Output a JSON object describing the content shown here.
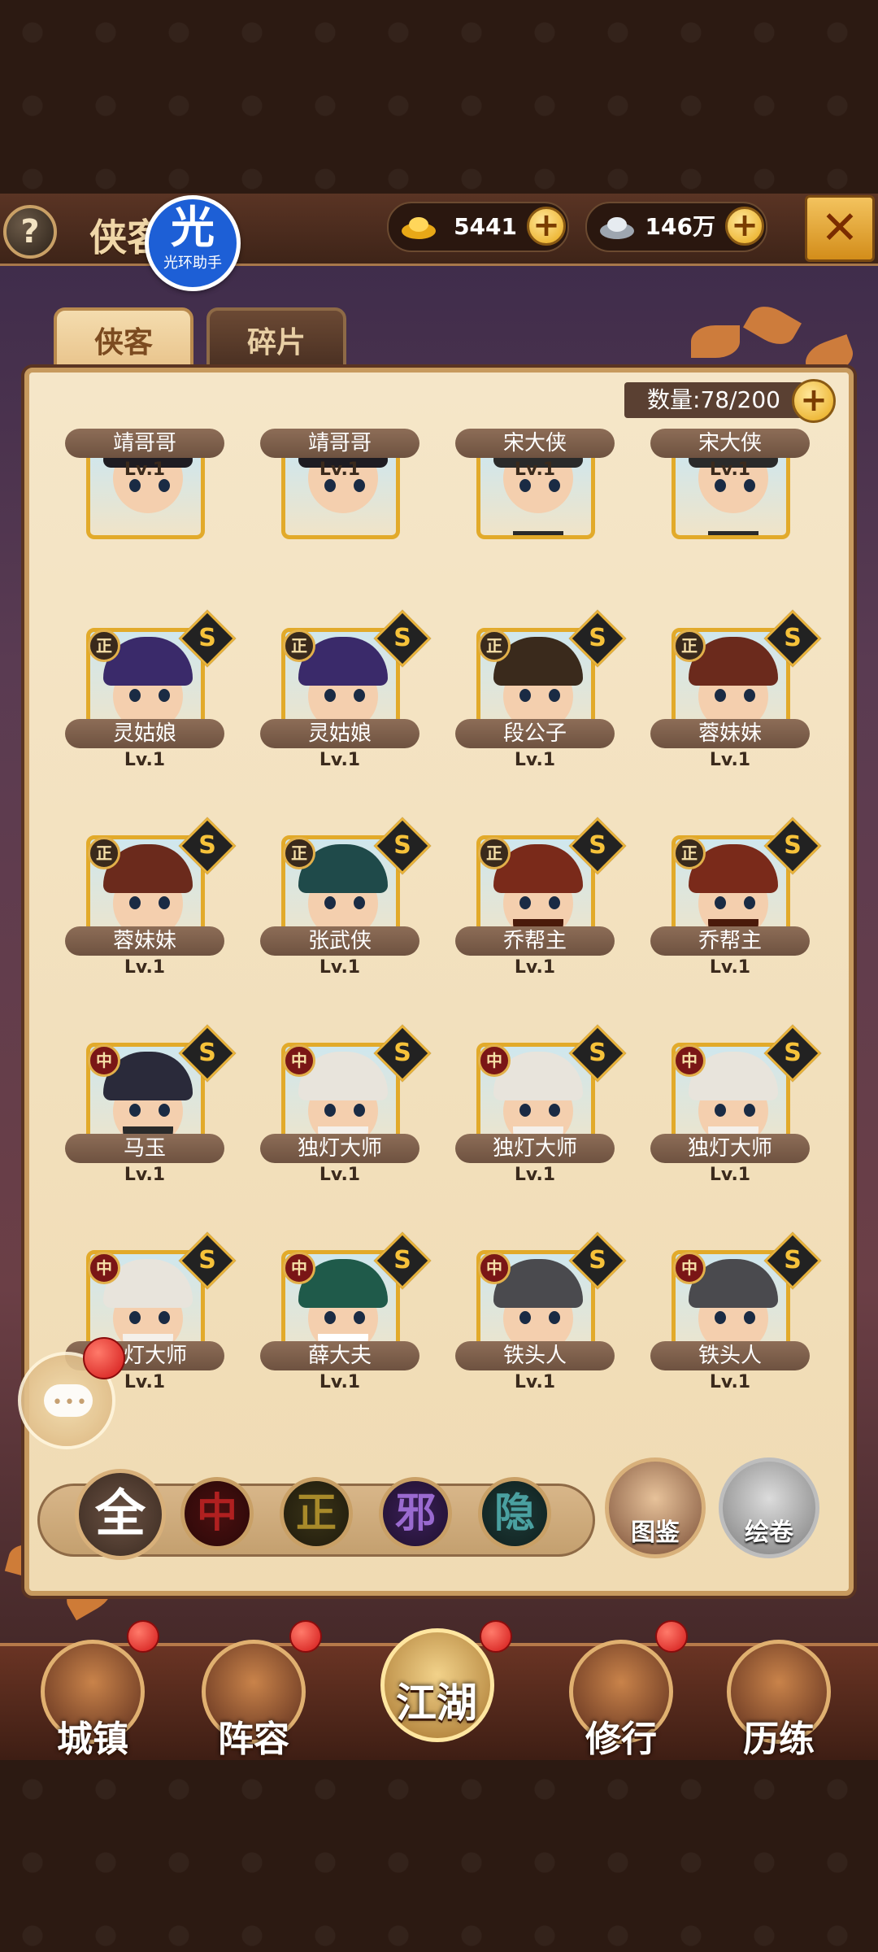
{
  "header": {
    "title": "侠客",
    "help_label": "?",
    "close_label": "✕",
    "logo": {
      "big": "光",
      "small": "光环助手"
    },
    "gold": {
      "value": "5441",
      "icon": "gold-ingot-icon"
    },
    "silver": {
      "value": "146万",
      "icon": "silver-ingot-icon"
    },
    "plus_label": "+"
  },
  "tabs": [
    {
      "label": "侠客"
    },
    {
      "label": "碎片"
    }
  ],
  "capacity": {
    "label": "数量:78/200"
  },
  "heroes": [
    {
      "name": "靖哥哥",
      "level": "Lv.1",
      "faction": "",
      "rank": "",
      "hair": "#1e1c22",
      "beard": ""
    },
    {
      "name": "靖哥哥",
      "level": "Lv.1",
      "faction": "",
      "rank": "",
      "hair": "#1e1c22",
      "beard": ""
    },
    {
      "name": "宋大侠",
      "level": "Lv.1",
      "faction": "",
      "rank": "",
      "hair": "#2a2a2a",
      "beard": "#2a2a2a"
    },
    {
      "name": "宋大侠",
      "level": "Lv.1",
      "faction": "",
      "rank": "",
      "hair": "#2a2a2a",
      "beard": "#2a2a2a"
    },
    {
      "name": "灵姑娘",
      "level": "Lv.1",
      "faction": "正",
      "rank": "S",
      "hair": "#3a2a6a",
      "beard": ""
    },
    {
      "name": "灵姑娘",
      "level": "Lv.1",
      "faction": "正",
      "rank": "S",
      "hair": "#3a2a6a",
      "beard": ""
    },
    {
      "name": "段公子",
      "level": "Lv.1",
      "faction": "正",
      "rank": "S",
      "hair": "#3a2a1c",
      "beard": ""
    },
    {
      "name": "蓉妹妹",
      "level": "Lv.1",
      "faction": "正",
      "rank": "S",
      "hair": "#6b2a1c",
      "beard": ""
    },
    {
      "name": "蓉妹妹",
      "level": "Lv.1",
      "faction": "正",
      "rank": "S",
      "hair": "#6b2a1c",
      "beard": ""
    },
    {
      "name": "张武侠",
      "level": "Lv.1",
      "faction": "正",
      "rank": "S",
      "hair": "#1f4a4a",
      "beard": ""
    },
    {
      "name": "乔帮主",
      "level": "Lv.1",
      "faction": "正",
      "rank": "S",
      "hair": "#7a2a1a",
      "beard": "#4a1a0a"
    },
    {
      "name": "乔帮主",
      "level": "Lv.1",
      "faction": "正",
      "rank": "S",
      "hair": "#7a2a1a",
      "beard": "#4a1a0a"
    },
    {
      "name": "马玉",
      "level": "Lv.1",
      "faction": "中",
      "rank": "S",
      "hair": "#2a2a3a",
      "beard": "#2a2a2a"
    },
    {
      "name": "独灯大师",
      "level": "Lv.1",
      "faction": "中",
      "rank": "S",
      "hair": "#e8e4dc",
      "beard": "#f4f0ea"
    },
    {
      "name": "独灯大师",
      "level": "Lv.1",
      "faction": "中",
      "rank": "S",
      "hair": "#e8e4dc",
      "beard": "#f4f0ea"
    },
    {
      "name": "独灯大师",
      "level": "Lv.1",
      "faction": "中",
      "rank": "S",
      "hair": "#e8e4dc",
      "beard": "#f4f0ea"
    },
    {
      "name": "独灯大师",
      "level": "Lv.1",
      "faction": "中",
      "rank": "S",
      "hair": "#e8e4dc",
      "beard": "#f4f0ea"
    },
    {
      "name": "薛大夫",
      "level": "Lv.1",
      "faction": "中",
      "rank": "S",
      "hair": "#1f5a4a",
      "beard": "#ffffff"
    },
    {
      "name": "铁头人",
      "level": "Lv.1",
      "faction": "中",
      "rank": "S",
      "hair": "#4a4a4e",
      "beard": ""
    },
    {
      "name": "铁头人",
      "level": "Lv.1",
      "faction": "中",
      "rank": "S",
      "hair": "#4a4a4e",
      "beard": ""
    }
  ],
  "filters": [
    {
      "label": "全"
    },
    {
      "label": "中"
    },
    {
      "label": "正"
    },
    {
      "label": "邪"
    },
    {
      "label": "隐"
    }
  ],
  "side_buttons": {
    "tujian": "图鉴",
    "huijuan": "绘卷"
  },
  "chat": {
    "dots": "•••"
  },
  "nav": [
    {
      "label": "城镇"
    },
    {
      "label": "阵容"
    },
    {
      "label": "江湖"
    },
    {
      "label": "修行"
    },
    {
      "label": "历练"
    }
  ]
}
